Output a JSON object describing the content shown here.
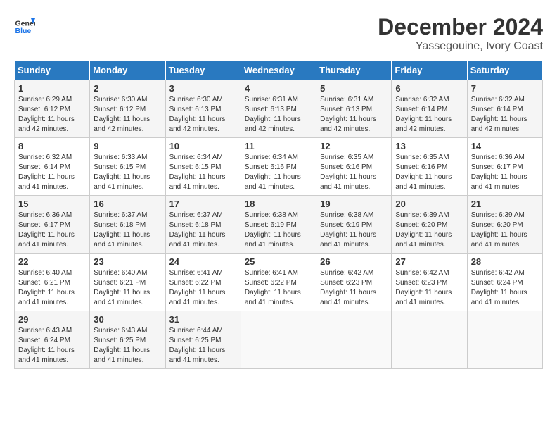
{
  "header": {
    "logo_line1": "General",
    "logo_line2": "Blue",
    "month_year": "December 2024",
    "location": "Yassegouine, Ivory Coast"
  },
  "weekdays": [
    "Sunday",
    "Monday",
    "Tuesday",
    "Wednesday",
    "Thursday",
    "Friday",
    "Saturday"
  ],
  "weeks": [
    [
      {
        "day": "1",
        "detail": "Sunrise: 6:29 AM\nSunset: 6:12 PM\nDaylight: 11 hours\nand 42 minutes."
      },
      {
        "day": "2",
        "detail": "Sunrise: 6:30 AM\nSunset: 6:12 PM\nDaylight: 11 hours\nand 42 minutes."
      },
      {
        "day": "3",
        "detail": "Sunrise: 6:30 AM\nSunset: 6:13 PM\nDaylight: 11 hours\nand 42 minutes."
      },
      {
        "day": "4",
        "detail": "Sunrise: 6:31 AM\nSunset: 6:13 PM\nDaylight: 11 hours\nand 42 minutes."
      },
      {
        "day": "5",
        "detail": "Sunrise: 6:31 AM\nSunset: 6:13 PM\nDaylight: 11 hours\nand 42 minutes."
      },
      {
        "day": "6",
        "detail": "Sunrise: 6:32 AM\nSunset: 6:14 PM\nDaylight: 11 hours\nand 42 minutes."
      },
      {
        "day": "7",
        "detail": "Sunrise: 6:32 AM\nSunset: 6:14 PM\nDaylight: 11 hours\nand 42 minutes."
      }
    ],
    [
      {
        "day": "8",
        "detail": "Sunrise: 6:32 AM\nSunset: 6:14 PM\nDaylight: 11 hours\nand 41 minutes."
      },
      {
        "day": "9",
        "detail": "Sunrise: 6:33 AM\nSunset: 6:15 PM\nDaylight: 11 hours\nand 41 minutes."
      },
      {
        "day": "10",
        "detail": "Sunrise: 6:34 AM\nSunset: 6:15 PM\nDaylight: 11 hours\nand 41 minutes."
      },
      {
        "day": "11",
        "detail": "Sunrise: 6:34 AM\nSunset: 6:16 PM\nDaylight: 11 hours\nand 41 minutes."
      },
      {
        "day": "12",
        "detail": "Sunrise: 6:35 AM\nSunset: 6:16 PM\nDaylight: 11 hours\nand 41 minutes."
      },
      {
        "day": "13",
        "detail": "Sunrise: 6:35 AM\nSunset: 6:16 PM\nDaylight: 11 hours\nand 41 minutes."
      },
      {
        "day": "14",
        "detail": "Sunrise: 6:36 AM\nSunset: 6:17 PM\nDaylight: 11 hours\nand 41 minutes."
      }
    ],
    [
      {
        "day": "15",
        "detail": "Sunrise: 6:36 AM\nSunset: 6:17 PM\nDaylight: 11 hours\nand 41 minutes."
      },
      {
        "day": "16",
        "detail": "Sunrise: 6:37 AM\nSunset: 6:18 PM\nDaylight: 11 hours\nand 41 minutes."
      },
      {
        "day": "17",
        "detail": "Sunrise: 6:37 AM\nSunset: 6:18 PM\nDaylight: 11 hours\nand 41 minutes."
      },
      {
        "day": "18",
        "detail": "Sunrise: 6:38 AM\nSunset: 6:19 PM\nDaylight: 11 hours\nand 41 minutes."
      },
      {
        "day": "19",
        "detail": "Sunrise: 6:38 AM\nSunset: 6:19 PM\nDaylight: 11 hours\nand 41 minutes."
      },
      {
        "day": "20",
        "detail": "Sunrise: 6:39 AM\nSunset: 6:20 PM\nDaylight: 11 hours\nand 41 minutes."
      },
      {
        "day": "21",
        "detail": "Sunrise: 6:39 AM\nSunset: 6:20 PM\nDaylight: 11 hours\nand 41 minutes."
      }
    ],
    [
      {
        "day": "22",
        "detail": "Sunrise: 6:40 AM\nSunset: 6:21 PM\nDaylight: 11 hours\nand 41 minutes."
      },
      {
        "day": "23",
        "detail": "Sunrise: 6:40 AM\nSunset: 6:21 PM\nDaylight: 11 hours\nand 41 minutes."
      },
      {
        "day": "24",
        "detail": "Sunrise: 6:41 AM\nSunset: 6:22 PM\nDaylight: 11 hours\nand 41 minutes."
      },
      {
        "day": "25",
        "detail": "Sunrise: 6:41 AM\nSunset: 6:22 PM\nDaylight: 11 hours\nand 41 minutes."
      },
      {
        "day": "26",
        "detail": "Sunrise: 6:42 AM\nSunset: 6:23 PM\nDaylight: 11 hours\nand 41 minutes."
      },
      {
        "day": "27",
        "detail": "Sunrise: 6:42 AM\nSunset: 6:23 PM\nDaylight: 11 hours\nand 41 minutes."
      },
      {
        "day": "28",
        "detail": "Sunrise: 6:42 AM\nSunset: 6:24 PM\nDaylight: 11 hours\nand 41 minutes."
      }
    ],
    [
      {
        "day": "29",
        "detail": "Sunrise: 6:43 AM\nSunset: 6:24 PM\nDaylight: 11 hours\nand 41 minutes."
      },
      {
        "day": "30",
        "detail": "Sunrise: 6:43 AM\nSunset: 6:25 PM\nDaylight: 11 hours\nand 41 minutes."
      },
      {
        "day": "31",
        "detail": "Sunrise: 6:44 AM\nSunset: 6:25 PM\nDaylight: 11 hours\nand 41 minutes."
      },
      {
        "day": "",
        "detail": ""
      },
      {
        "day": "",
        "detail": ""
      },
      {
        "day": "",
        "detail": ""
      },
      {
        "day": "",
        "detail": ""
      }
    ]
  ]
}
